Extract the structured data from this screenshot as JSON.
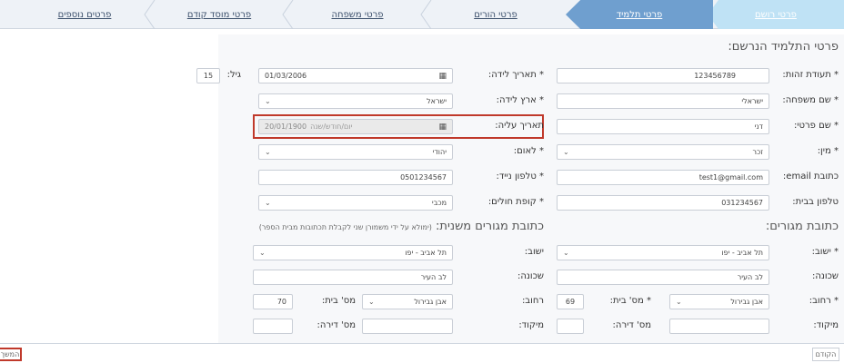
{
  "steps": [
    {
      "label": "פרטי רושם"
    },
    {
      "label": "פרטי תלמיד"
    },
    {
      "label": "פרטי הורים"
    },
    {
      "label": "פרטי משפחה"
    },
    {
      "label": "פרטי מוסד קודם"
    },
    {
      "label": "פרטים נוספים"
    }
  ],
  "student": {
    "title": "פרטי התלמיד הנרשם:",
    "id_label": "* תעודת זהות:",
    "id_value": "123456789",
    "birthdate_label": "* תאריך לידה:",
    "birthdate_value": "01/03/2006",
    "age_label": "גיל:",
    "age_value": "15",
    "lastname_label": "* שם משפחה:",
    "lastname_value": "ישראלי",
    "birthcountry_label": "* ארץ לידה:",
    "birthcountry_value": "ישראל",
    "firstname_label": "* שם פרטי:",
    "firstname_value": "דני",
    "aliya_label": "תאריך עליה:",
    "aliya_value": "20/01/1900",
    "aliya_placeholder": "יום/חודש/שנה",
    "gender_label": "* מין:",
    "gender_value": "זכר",
    "nation_label": "* לאום:",
    "nation_value": "יהודי",
    "email_label": "כתובת email:",
    "email_value": "test1@gmail.com",
    "mobile_label": "* טלפון נייד:",
    "mobile_value": "0501234567",
    "homephone_label": "טלפון בבית:",
    "homephone_value": "031234567",
    "hmo_label": "* קופת חולים:",
    "hmo_value": "מכבי"
  },
  "address": {
    "title": "כתובת מגורים:",
    "city_label": "* ישוב:",
    "city_value": "תל אביב - יפו",
    "neighborhood_label": "שכונה:",
    "neighborhood_value": "לב העיר",
    "street_label": "* רחוב:",
    "street_value": "אבן גבירול",
    "house_label": "* מס' בית:",
    "house_value": "69",
    "zip_label": "מיקוד:",
    "zip_value": "",
    "apt_label": "מס' דירה:",
    "apt_value": ""
  },
  "alt_address": {
    "title": "כתובת מגורים משנית:",
    "note": "(ימולא על ידי משמורן שני לקבלת תכתובות מבית הספר)",
    "city_label": "ישוב:",
    "city_value": "תל אביב - יפו",
    "neighborhood_label": "שכונה:",
    "neighborhood_value": "לב העיר",
    "street_label": "רחוב:",
    "street_value": "אבן גבירול",
    "house_label": "מס' בית:",
    "house_value": "70",
    "zip_label": "מיקוד:",
    "zip_value": "",
    "apt_label": "מס' דירה:",
    "apt_value": ""
  },
  "buttons": {
    "prev": "הקודם",
    "next": "המשך"
  },
  "icons": {
    "calendar": "calendar-icon",
    "dropdown": "chevron-down-icon"
  },
  "colors": {
    "active_step": "#6f9fcf",
    "first_step": "#bfe2f5",
    "highlight": "#c0392b"
  }
}
